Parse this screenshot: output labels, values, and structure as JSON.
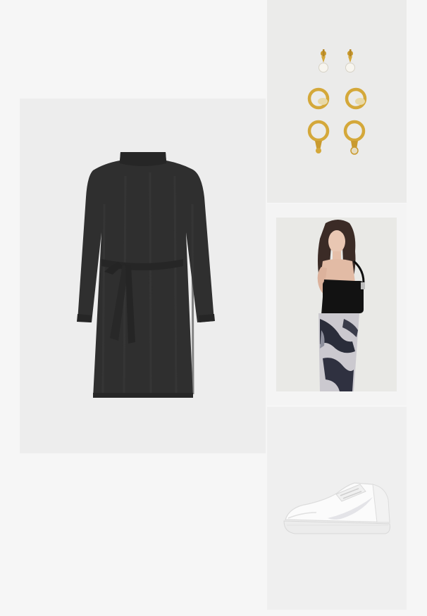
{
  "outfit": {
    "items": [
      {
        "item": "dress",
        "icon": "dress-icon",
        "color": "#2e2e2e"
      },
      {
        "item": "earrings",
        "icon": "earrings-icon",
        "color": "#d4a83a"
      },
      {
        "item": "bag",
        "icon": "bag-icon",
        "color": "#141414"
      },
      {
        "item": "sneaker",
        "icon": "sneaker-icon",
        "color": "#f8f8f8"
      }
    ]
  }
}
